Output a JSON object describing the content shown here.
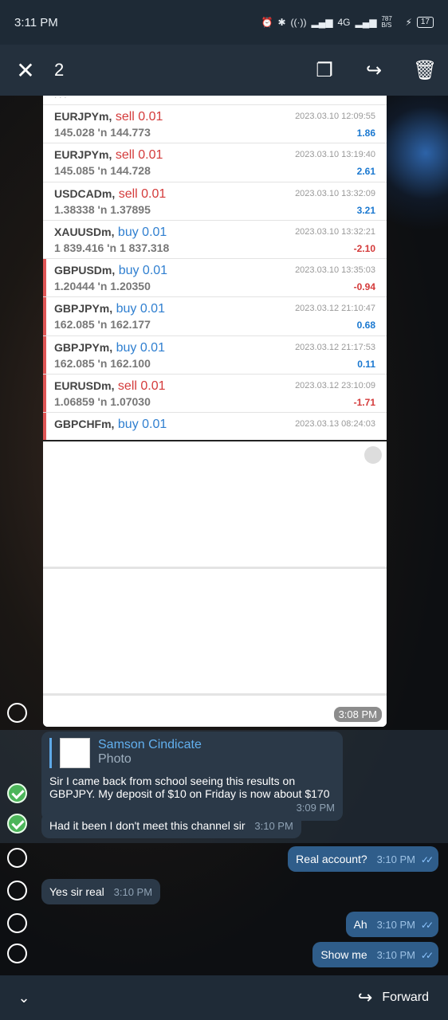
{
  "status_bar": {
    "time": "3:11 PM",
    "signal": "4G",
    "net_speed": "787 B/S",
    "battery": "17"
  },
  "toolbar": {
    "selected_count": "2"
  },
  "trades": [
    {
      "symbol": "EURJPYm,",
      "side": "sell 0.01",
      "side_type": "sell",
      "prices": "145.028 'n 144.773",
      "date": "2023.03.10 12:09:55",
      "profit": "1.86",
      "profit_type": "pos",
      "marked": false
    },
    {
      "symbol": "EURJPYm,",
      "side": "sell 0.01",
      "side_type": "sell",
      "prices": "145.085 'n 144.728",
      "date": "2023.03.10 13:19:40",
      "profit": "2.61",
      "profit_type": "pos",
      "marked": false
    },
    {
      "symbol": "USDCADm,",
      "side": "sell 0.01",
      "side_type": "sell",
      "prices": "1.38338 'n 1.37895",
      "date": "2023.03.10 13:32:09",
      "profit": "3.21",
      "profit_type": "pos",
      "marked": false
    },
    {
      "symbol": "XAUUSDm,",
      "side": "buy 0.01",
      "side_type": "buy",
      "prices": "1 839.416 'n 1 837.318",
      "date": "2023.03.10 13:32:21",
      "profit": "-2.10",
      "profit_type": "neg",
      "marked": false
    },
    {
      "symbol": "GBPUSDm,",
      "side": "buy 0.01",
      "side_type": "buy",
      "prices": "1.20444 'n 1.20350",
      "date": "2023.03.10 13:35:03",
      "profit": "-0.94",
      "profit_type": "neg",
      "marked": true
    },
    {
      "symbol": "GBPJPYm,",
      "side": "buy 0.01",
      "side_type": "buy",
      "prices": "162.085 'n 162.177",
      "date": "2023.03.12 21:10:47",
      "profit": "0.68",
      "profit_type": "pos",
      "marked": true
    },
    {
      "symbol": "GBPJPYm,",
      "side": "buy 0.01",
      "side_type": "buy",
      "prices": "162.085 'n 162.100",
      "date": "2023.03.12 21:17:53",
      "profit": "0.11",
      "profit_type": "pos",
      "marked": true
    },
    {
      "symbol": "EURUSDm,",
      "side": "sell 0.01",
      "side_type": "sell",
      "prices": "1.06859 'n 1.07030",
      "date": "2023.03.12 23:10:09",
      "profit": "-1.71",
      "profit_type": "neg",
      "marked": true
    },
    {
      "symbol": "GBPCHFm,",
      "side": "buy 0.01",
      "side_type": "buy",
      "prices": "",
      "date": "2023.03.13 08:24:03",
      "profit": "",
      "profit_type": "neg",
      "marked": true
    }
  ],
  "photo_message": {
    "time": "3:08 PM"
  },
  "messages": {
    "reply_msg": {
      "reply_name": "Samson Cindicate",
      "reply_sub": "Photo",
      "text": "Sir I  came back from school seeing this results on GBPJPY. My deposit of $10 on Friday is now about $170",
      "time": "3:09 PM"
    },
    "msg2": {
      "text": "Had it been I don't meet this channel sir",
      "time": "3:10 PM"
    },
    "msg3": {
      "text": "Real account?",
      "time": "3:10 PM"
    },
    "msg4": {
      "text": "Yes sir real",
      "time": "3:10 PM"
    },
    "msg5": {
      "text": "Ah",
      "time": "3:10 PM"
    },
    "msg6": {
      "text": "Show me",
      "time": "3:10 PM"
    }
  },
  "bottom_bar": {
    "forward_label": "Forward"
  },
  "colors": {
    "accent": "#5ea9e8",
    "check_selected": "#4cb55a",
    "sell": "#d43a3a",
    "buy": "#2f7fd0"
  }
}
